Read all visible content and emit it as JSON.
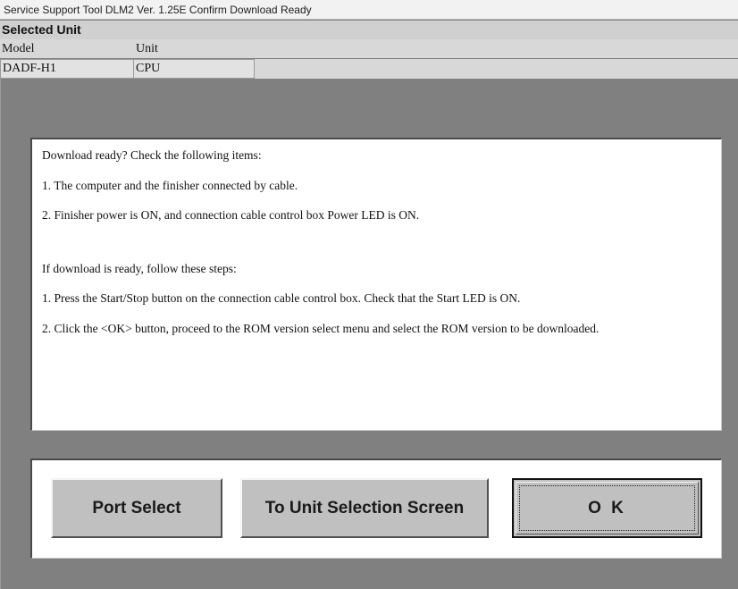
{
  "window": {
    "title": "Service Support Tool DLM2 Ver. 1.25E  Confirm Download Ready"
  },
  "selected_unit": {
    "header": "Selected Unit",
    "columns": [
      "Model",
      "Unit"
    ],
    "values": [
      "DADF-H1",
      "CPU"
    ]
  },
  "message": {
    "lines": [
      "Download ready? Check the following items:",
      "1. The computer and the finisher connected by cable.",
      "2. Finisher power is ON, and connection cable control box Power LED is ON.",
      "If download is ready, follow these steps:",
      "1. Press the Start/Stop button on the connection cable control box. Check that the Start LED is ON.",
      "2. Click the <OK> button, proceed to the ROM version select menu and select the ROM version to be downloaded."
    ]
  },
  "buttons": {
    "port_select": "Port Select",
    "unit_selection": "To Unit Selection Screen",
    "ok": "O K"
  }
}
